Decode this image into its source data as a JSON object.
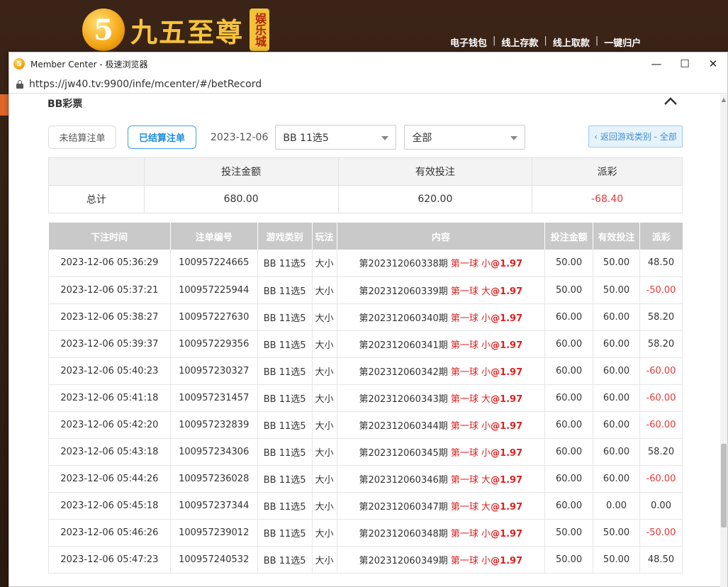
{
  "site": {
    "logo_numeral": "5",
    "logo_text": "九五至尊",
    "logo_tag": "娱乐城",
    "nav": [
      "电子钱包",
      "线上存款",
      "线上取款",
      "一键归户"
    ]
  },
  "window": {
    "title": "Member Center - 极速浏览器",
    "url": "https://jw40.tv:9900/infe/mcenter/#/betRecord",
    "controls": {
      "minimize": "—",
      "maximize": "☐",
      "close": "✕"
    }
  },
  "section": {
    "title": "BB彩票"
  },
  "filters": {
    "unsettled_label": "未结算注单",
    "settled_label": "已结算注单",
    "date": "2023-12-06",
    "game_select": "BB 11选5",
    "play_select": "全部",
    "back_label": "‹ 返回游戏类别 - 全部"
  },
  "summary": {
    "headers": [
      "",
      "投注金额",
      "有效投注",
      "派彩"
    ],
    "label": "总计",
    "bet_amount": "680.00",
    "valid_bet": "620.00",
    "payout": "-68.40"
  },
  "records": {
    "headers": [
      "下注时间",
      "注单编号",
      "游戏类别",
      "玩法",
      "内容",
      "投注金额",
      "有效投注",
      "派彩"
    ],
    "rows": [
      {
        "time": "2023-12-06 05:36:29",
        "id": "100957224665",
        "game": "BB 11选5",
        "play": "大小",
        "period": "第202312060338期",
        "pick": "第一球 小",
        "odds": "@1.97",
        "bet": "50.00",
        "valid": "50.00",
        "payout": "48.50"
      },
      {
        "time": "2023-12-06 05:37:21",
        "id": "100957225944",
        "game": "BB 11选5",
        "play": "大小",
        "period": "第202312060339期",
        "pick": "第一球 大",
        "odds": "@1.97",
        "bet": "50.00",
        "valid": "50.00",
        "payout": "-50.00"
      },
      {
        "time": "2023-12-06 05:38:27",
        "id": "100957227630",
        "game": "BB 11选5",
        "play": "大小",
        "period": "第202312060340期",
        "pick": "第一球 小",
        "odds": "@1.97",
        "bet": "60.00",
        "valid": "60.00",
        "payout": "58.20"
      },
      {
        "time": "2023-12-06 05:39:37",
        "id": "100957229356",
        "game": "BB 11选5",
        "play": "大小",
        "period": "第202312060341期",
        "pick": "第一球 小",
        "odds": "@1.97",
        "bet": "60.00",
        "valid": "60.00",
        "payout": "58.20"
      },
      {
        "time": "2023-12-06 05:40:23",
        "id": "100957230327",
        "game": "BB 11选5",
        "play": "大小",
        "period": "第202312060342期",
        "pick": "第一球 小",
        "odds": "@1.97",
        "bet": "60.00",
        "valid": "60.00",
        "payout": "-60.00"
      },
      {
        "time": "2023-12-06 05:41:18",
        "id": "100957231457",
        "game": "BB 11选5",
        "play": "大小",
        "period": "第202312060343期",
        "pick": "第一球 大",
        "odds": "@1.97",
        "bet": "60.00",
        "valid": "60.00",
        "payout": "-60.00"
      },
      {
        "time": "2023-12-06 05:42:20",
        "id": "100957232839",
        "game": "BB 11选5",
        "play": "大小",
        "period": "第202312060344期",
        "pick": "第一球 小",
        "odds": "@1.97",
        "bet": "60.00",
        "valid": "60.00",
        "payout": "-60.00"
      },
      {
        "time": "2023-12-06 05:43:18",
        "id": "100957234306",
        "game": "BB 11选5",
        "play": "大小",
        "period": "第202312060345期",
        "pick": "第一球 小",
        "odds": "@1.97",
        "bet": "60.00",
        "valid": "60.00",
        "payout": "58.20"
      },
      {
        "time": "2023-12-06 05:44:26",
        "id": "100957236028",
        "game": "BB 11选5",
        "play": "大小",
        "period": "第202312060346期",
        "pick": "第一球 大",
        "odds": "@1.97",
        "bet": "60.00",
        "valid": "60.00",
        "payout": "-60.00"
      },
      {
        "time": "2023-12-06 05:45:18",
        "id": "100957237344",
        "game": "BB 11选5",
        "play": "大小",
        "period": "第202312060347期",
        "pick": "第一球 大",
        "odds": "@1.97",
        "bet": "60.00",
        "valid": "0.00",
        "payout": "0.00"
      },
      {
        "time": "2023-12-06 05:46:26",
        "id": "100957239012",
        "game": "BB 11选5",
        "play": "大小",
        "period": "第202312060348期",
        "pick": "第一球 小",
        "odds": "@1.97",
        "bet": "50.00",
        "valid": "50.00",
        "payout": "-50.00"
      },
      {
        "time": "2023-12-06 05:47:23",
        "id": "100957240532",
        "game": "BB 11选5",
        "play": "大小",
        "period": "第202312060349期",
        "pick": "第一球 小",
        "odds": "@1.97",
        "bet": "50.00",
        "valid": "50.00",
        "payout": "48.50"
      }
    ]
  },
  "colors": {
    "negative": "#e53935",
    "accent": "#1d8de0",
    "pick": "#e02020"
  }
}
